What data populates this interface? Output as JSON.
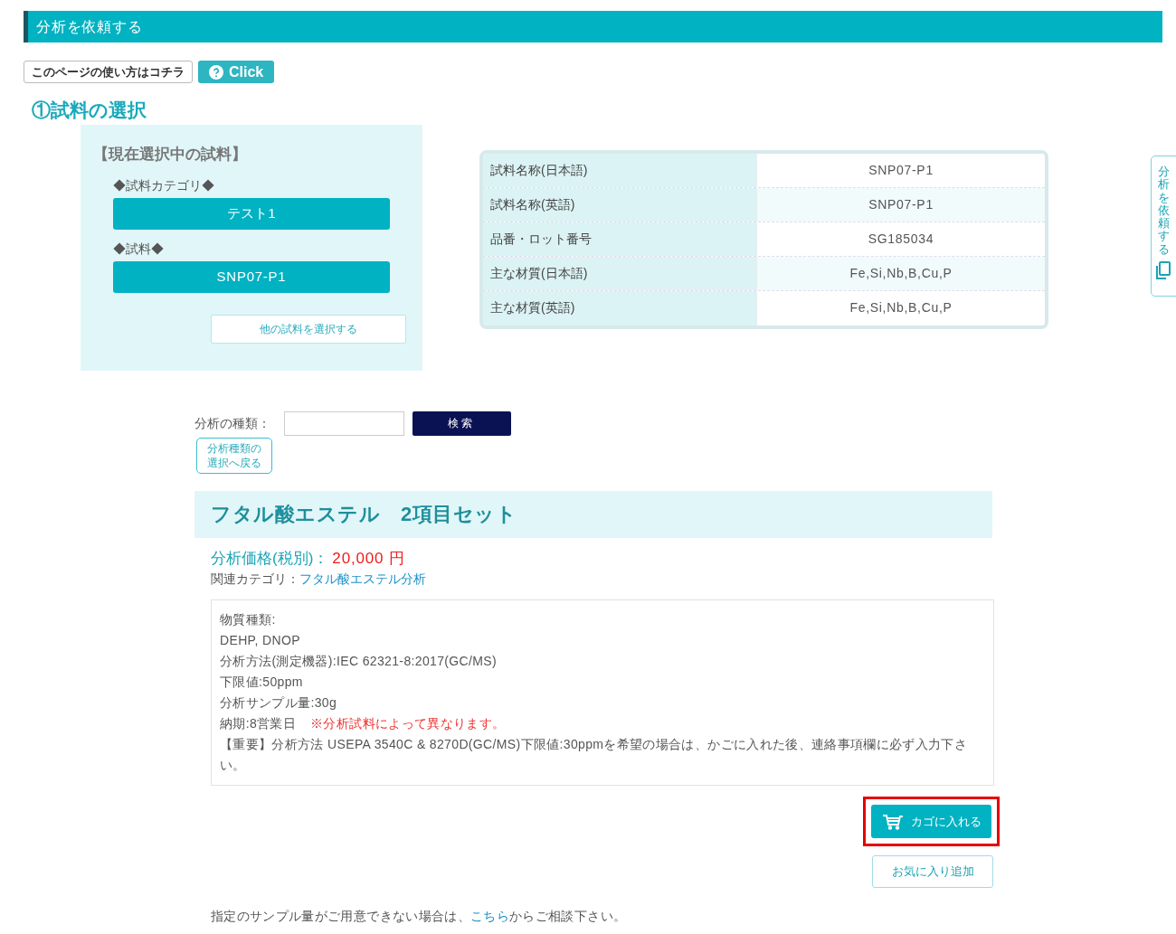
{
  "header": {
    "title": "分析を依頼する"
  },
  "help": {
    "label": "このページの使い方はコチラ",
    "button": "Click"
  },
  "section_title": "①試料の選択",
  "current_sample": {
    "heading": "【現在選択中の試料】",
    "category_label": "◆試料カテゴリ◆",
    "category_value": "テスト1",
    "sample_label": "◆試料◆",
    "sample_value": "SNP07-P1",
    "change_button": "他の試料を選択する"
  },
  "sample_table": [
    {
      "label": "試料名称(日本語)",
      "value": "SNP07-P1"
    },
    {
      "label": "試料名称(英語)",
      "value": "SNP07-P1"
    },
    {
      "label": "品番・ロット番号",
      "value": "SG185034"
    },
    {
      "label": "主な材質(日本語)",
      "value": "Fe,Si,Nb,B,Cu,P"
    },
    {
      "label": "主な材質(英語)",
      "value": "Fe,Si,Nb,B,Cu,P"
    }
  ],
  "side_tab": {
    "label": "分析を依頼する"
  },
  "search": {
    "label": "分析の種類：",
    "button": "検索",
    "back_button": "分析種類の選択へ戻る"
  },
  "product": {
    "title": "フタル酸エステル　2項目セット",
    "price_label": "分析価格(税別)：",
    "price": "20,000 円",
    "category_label": "関連カテゴリ：",
    "category_link": "フタル酸エステル分析",
    "details": [
      {
        "text": "物質種類:"
      },
      {
        "text": "DEHP, DNOP"
      },
      {
        "text": "分析方法(測定機器):IEC 62321-8:2017(GC/MS)"
      },
      {
        "text": "下限値:50ppm"
      },
      {
        "text": "分析サンプル量:30g"
      },
      {
        "text": "納期:8営業日",
        "note": "※分析試料によって異なります。"
      },
      {
        "text": "【重要】分析方法 USEPA 3540C & 8270D(GC/MS)下限値:30ppmを希望の場合は、かごに入れた後、連絡事項欄に必ず入力下さい。"
      }
    ],
    "cart_button": {
      "label": "カゴに入れる",
      "highlighted": true
    },
    "favorite_button": "お気に入り追加"
  },
  "footer": {
    "before": "指定のサンプル量がご用意できない場合は、",
    "link": "こちら",
    "after": "からご相談下さい。"
  }
}
